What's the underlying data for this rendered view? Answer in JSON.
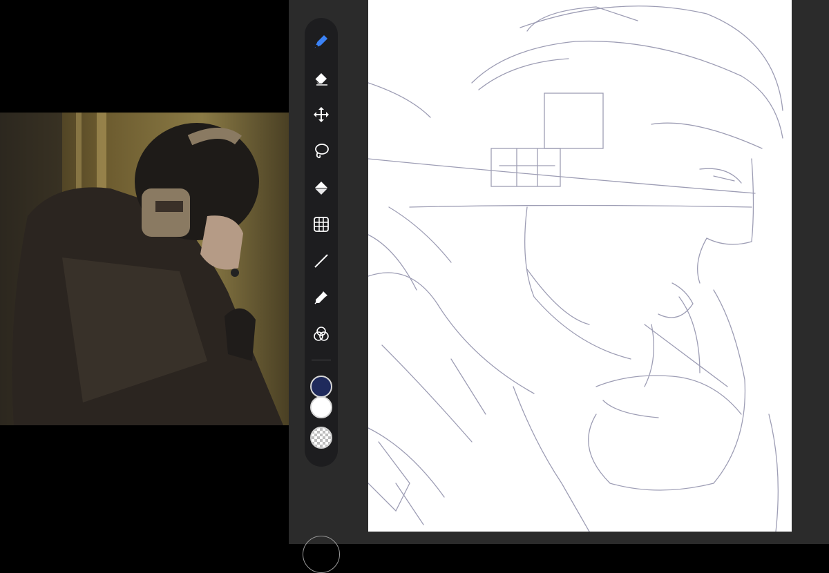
{
  "reference": {
    "label": ""
  },
  "toolbar": {
    "tools": [
      {
        "name": "pen",
        "icon": "pen-icon",
        "active": true
      },
      {
        "name": "eraser",
        "icon": "eraser-icon"
      },
      {
        "name": "move",
        "icon": "move-icon"
      },
      {
        "name": "lasso",
        "icon": "lasso-icon"
      },
      {
        "name": "fill",
        "icon": "fill-icon"
      },
      {
        "name": "transform",
        "icon": "transform-grid-icon"
      },
      {
        "name": "line",
        "icon": "line-icon"
      },
      {
        "name": "eyedropper",
        "icon": "eyedropper-icon"
      },
      {
        "name": "blend",
        "icon": "blend-circles-icon"
      }
    ],
    "colors": {
      "primary": "#1f2a5c",
      "secondary": "#ffffff",
      "active_tool": "#3b82f6",
      "icon": "#ffffff"
    }
  },
  "canvas": {
    "background": "#ffffff",
    "sketch_color": "#8c8ca8"
  }
}
